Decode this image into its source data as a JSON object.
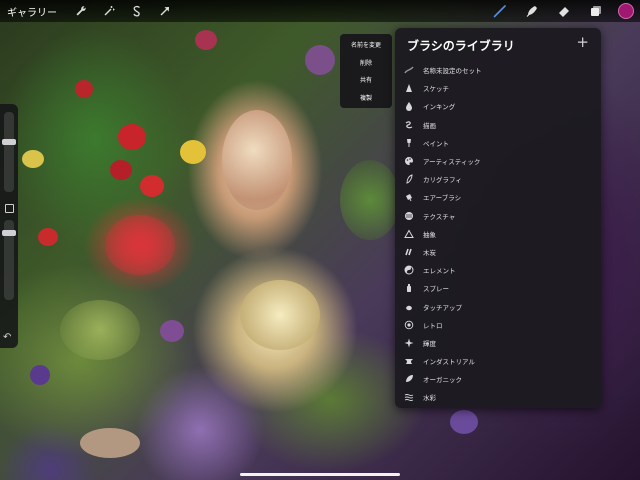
{
  "toolbar": {
    "gallery_label": "ギャラリー",
    "left_icons": [
      "wrench-icon",
      "magic-wand-icon",
      "selection-icon",
      "transform-arrow-icon"
    ],
    "right_icons": [
      "brush-icon",
      "smudge-icon",
      "eraser-icon",
      "layers-icon"
    ],
    "current_color": "#a0186f"
  },
  "context_menu": {
    "items": [
      "名前を変更",
      "削除",
      "共有",
      "複製"
    ]
  },
  "brush_library": {
    "title": "ブラシのライブラリ",
    "add_label": "+",
    "items": [
      {
        "label": "名称未設定のセット",
        "icon": "stroke-icon"
      },
      {
        "label": "スケッチ",
        "icon": "pencil-tip-icon"
      },
      {
        "label": "インキング",
        "icon": "ink-drop-icon"
      },
      {
        "label": "描画",
        "icon": "scribble-icon"
      },
      {
        "label": "ペイント",
        "icon": "paint-brush-icon"
      },
      {
        "label": "アーティスティック",
        "icon": "palette-icon"
      },
      {
        "label": "カリグラフィ",
        "icon": "calligraphy-icon"
      },
      {
        "label": "エアーブラシ",
        "icon": "airbrush-icon"
      },
      {
        "label": "テクスチャ",
        "icon": "texture-icon"
      },
      {
        "label": "抽象",
        "icon": "triangle-icon"
      },
      {
        "label": "木炭",
        "icon": "charcoal-icon"
      },
      {
        "label": "エレメント",
        "icon": "yin-yang-icon"
      },
      {
        "label": "スプレー",
        "icon": "spray-can-icon"
      },
      {
        "label": "タッチアップ",
        "icon": "touchup-icon"
      },
      {
        "label": "レトロ",
        "icon": "retro-circle-icon"
      },
      {
        "label": "輝度",
        "icon": "sparkle-icon"
      },
      {
        "label": "インダストリアル",
        "icon": "anvil-icon"
      },
      {
        "label": "オーガニック",
        "icon": "leaf-icon"
      },
      {
        "label": "水彩",
        "icon": "waves-icon"
      }
    ]
  },
  "sidebar": {
    "brush_size_level": 0.2,
    "opacity_level": 0.3,
    "undo_label": "↶"
  }
}
